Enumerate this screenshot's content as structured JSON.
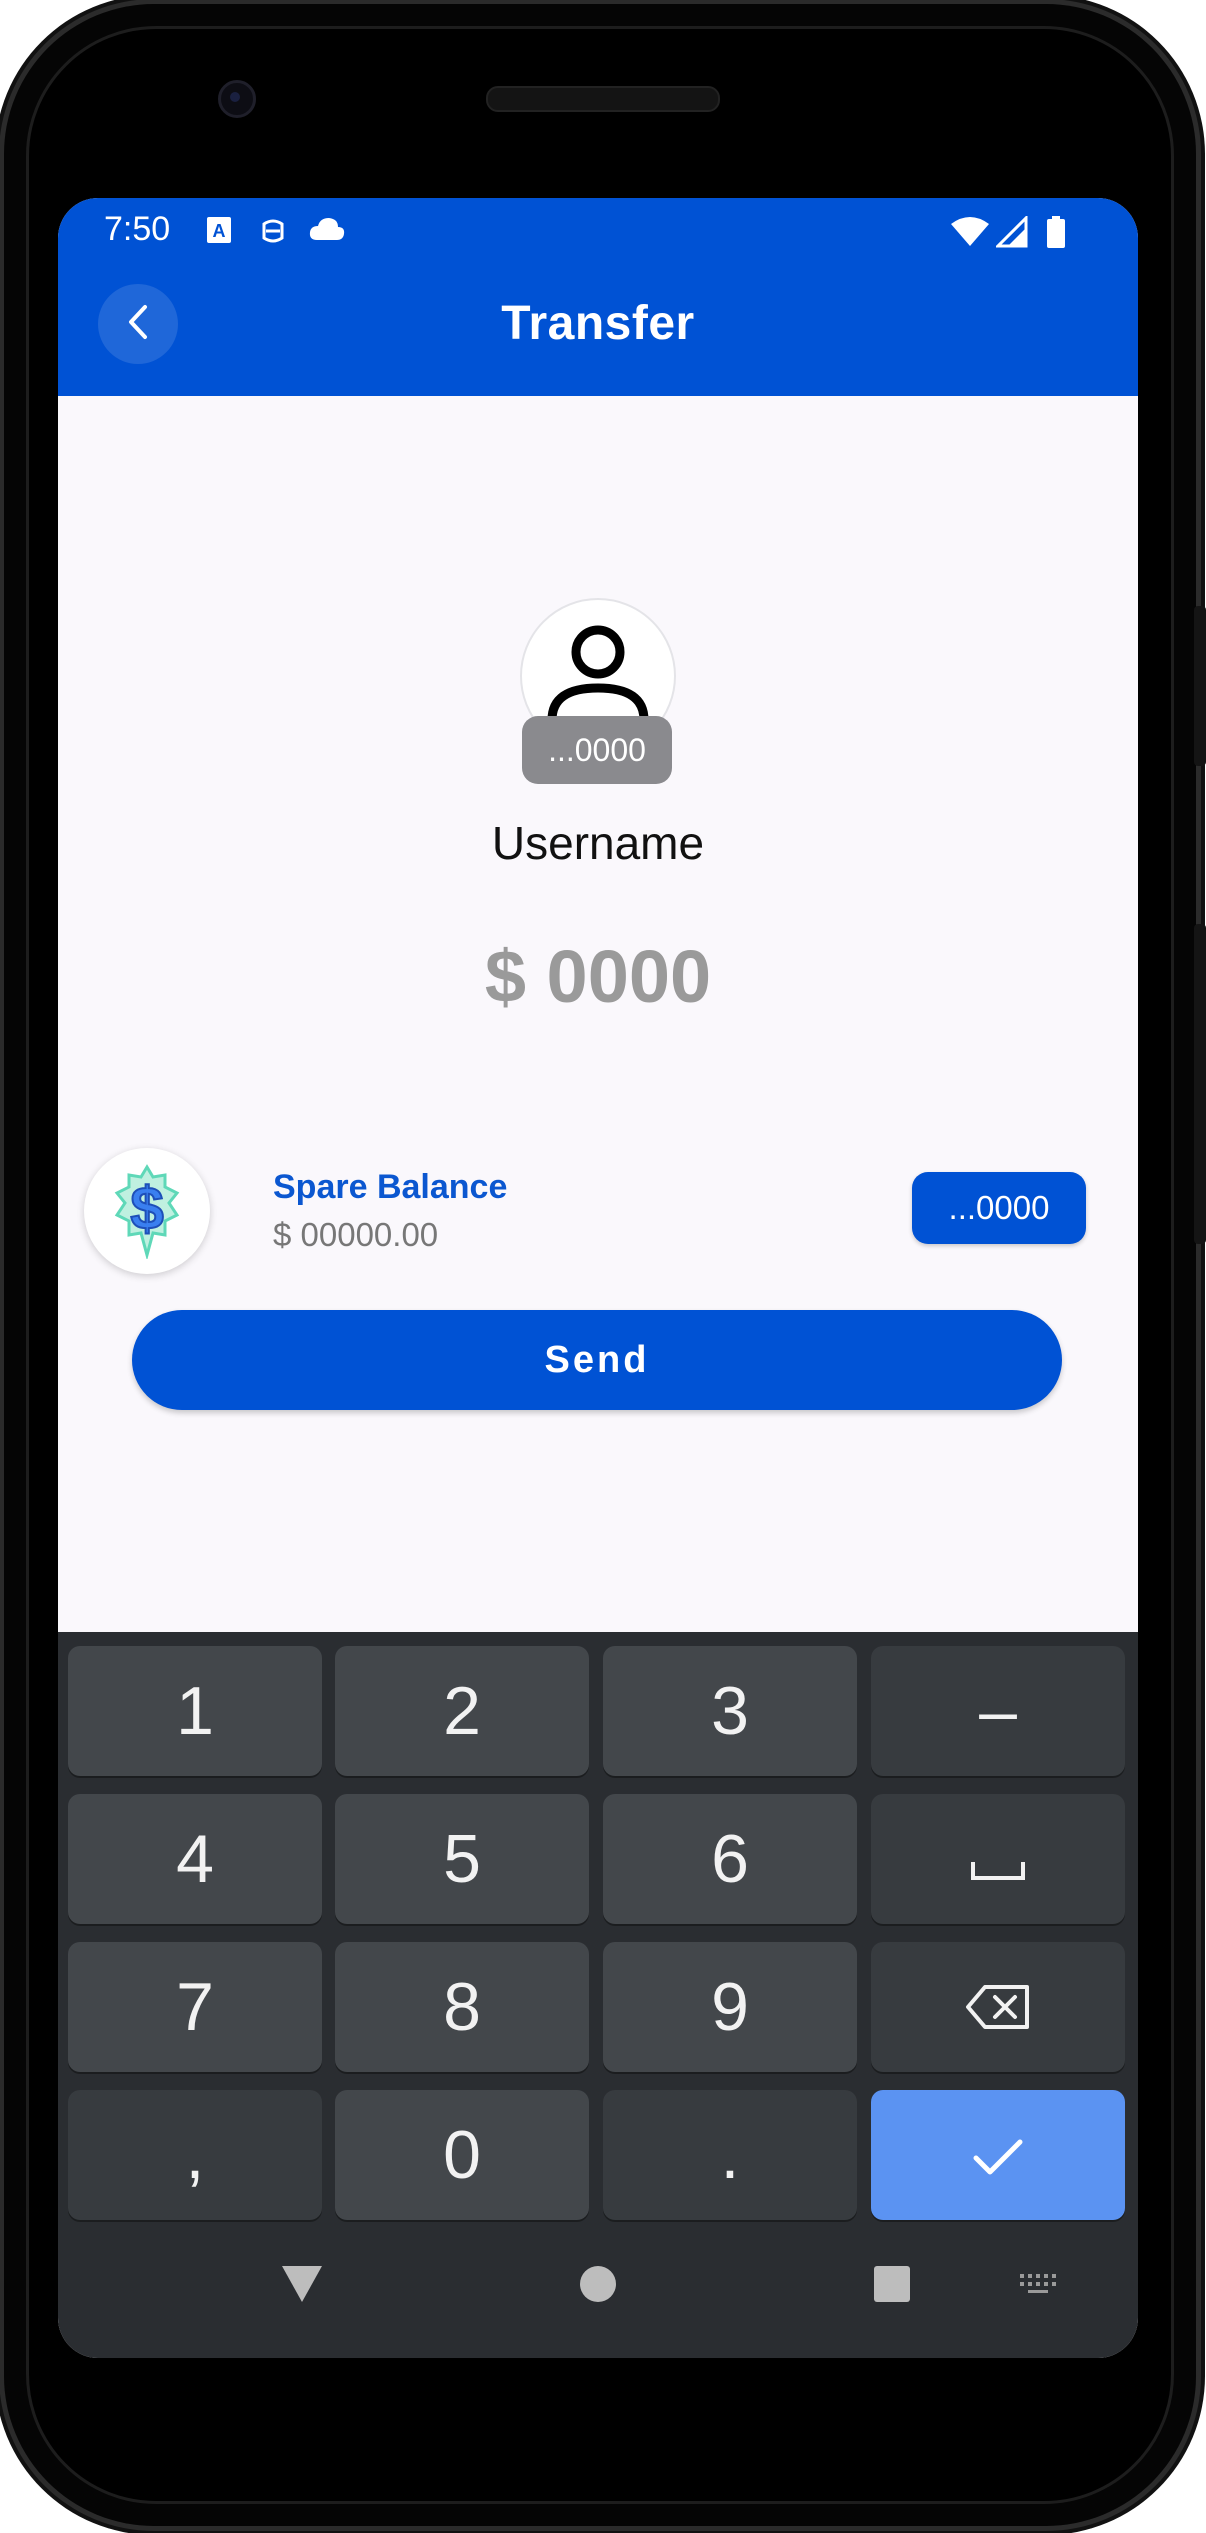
{
  "status_bar": {
    "time": "7:50",
    "icons": [
      "a-box-icon",
      "robot-icon",
      "cloud-icon",
      "wifi-icon",
      "signal-icon",
      "battery-icon"
    ]
  },
  "app_bar": {
    "title": "Transfer",
    "back_icon": "chevron-left-icon",
    "background": "#0052d4"
  },
  "recipient": {
    "avatar_icon": "person-icon",
    "account_chip": "...0000",
    "username": "Username",
    "amount": "$ 0000"
  },
  "source_account": {
    "icon": "dollar-coin-icon",
    "label": "Spare Balance",
    "balance": "$ 00000.00",
    "account_button": "...0000"
  },
  "send_button": {
    "label": "Send"
  },
  "keyboard": {
    "rows": [
      [
        "1",
        "2",
        "3",
        "–"
      ],
      [
        "4",
        "5",
        "6",
        "space-icon"
      ],
      [
        "7",
        "8",
        "9",
        "backspace-icon"
      ],
      [
        ",",
        "0",
        ".",
        "check-icon"
      ]
    ]
  },
  "nav_bar": {
    "icons": [
      "back-triangle-icon",
      "home-circle-icon",
      "recents-square-icon",
      "keyboard-switch-icon"
    ]
  },
  "colors": {
    "brand": "#0052d4",
    "enter_key": "#5b93f2",
    "keyboard_bg": "#2a2d31"
  }
}
